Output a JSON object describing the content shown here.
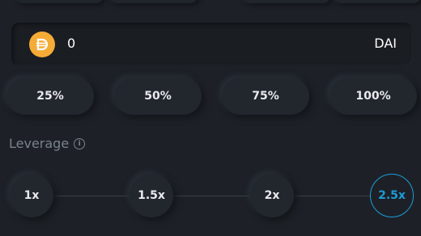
{
  "amount": {
    "value": "0",
    "token_symbol": "DAI",
    "token_icon": "dai-icon",
    "token_color": "#f5ac37"
  },
  "percent_buttons": [
    "25%",
    "50%",
    "75%",
    "100%"
  ],
  "leverage": {
    "label": "Leverage",
    "options": [
      "1x",
      "1.5x",
      "2x",
      "2.5x"
    ],
    "selected": "2.5x",
    "accent_color": "#1e9bd7"
  }
}
